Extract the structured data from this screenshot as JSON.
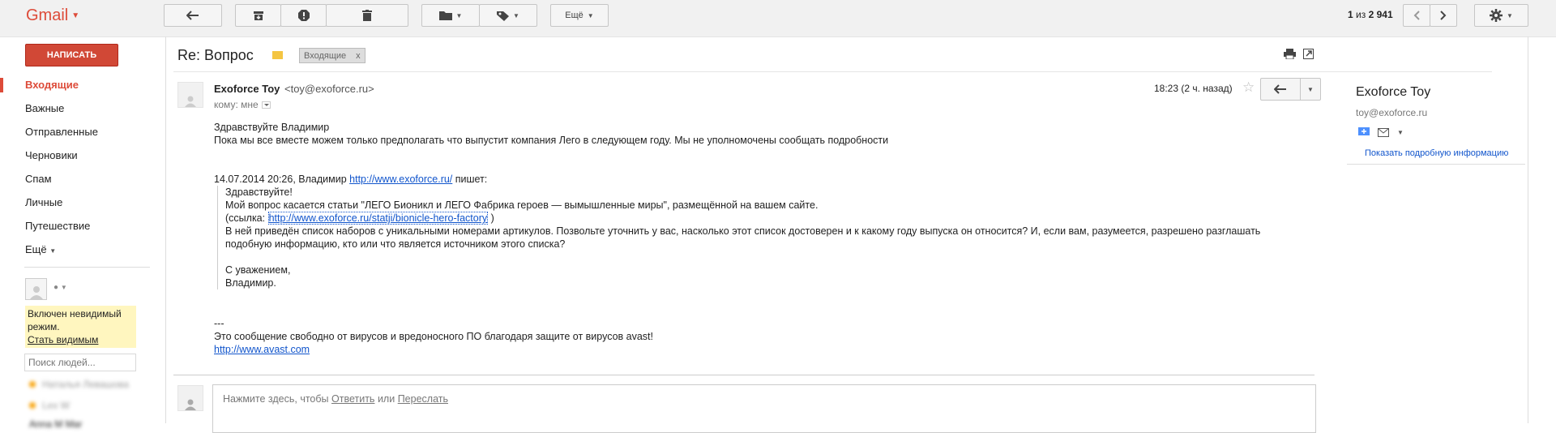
{
  "header": {
    "logo": "Gmail",
    "more_label": "Ещё",
    "pager": {
      "range": "1",
      "of_label": "из",
      "total": "2 941"
    }
  },
  "compose": {
    "label": "НАПИСАТЬ"
  },
  "sidebar": {
    "items": [
      {
        "label": "Входящие",
        "active": true
      },
      {
        "label": "Важные"
      },
      {
        "label": "Отправленные"
      },
      {
        "label": "Черновики"
      },
      {
        "label": "Спам"
      },
      {
        "label": "Личные"
      },
      {
        "label": "Путешествие"
      },
      {
        "label": "Ещё"
      }
    ],
    "chat": {
      "invisible_line1": "Включен невидимый",
      "invisible_line2": "режим.",
      "become_visible": "Стать видимым",
      "search_placeholder": "Поиск людей..."
    },
    "contacts": [
      "Наталья Левашова",
      "Lex W",
      "Anna M Mar"
    ]
  },
  "message": {
    "subject": "Re: Вопрос",
    "label_chip": "Входящие",
    "from_name": "Exoforce Toy",
    "from_email": "<toy@exoforce.ru>",
    "to_label": "кому: мне",
    "time": "18:23 (2 ч. назад)",
    "body": {
      "greeting": "Здравствуйте Владимир",
      "line1": "Пока мы все вместе можем только предполагать что выпустит компания Лего в следующем году. Мы не уполномочены сообщать подробности",
      "quote_header_prefix": "14.07.2014 20:26, Владимир",
      "quote_header_link": "http://www.exoforce.ru/",
      "quote_header_suffix": "пишет:",
      "quote": {
        "l1": "Здравствуйте!",
        "l2": "Мой вопрос касается статьи \"ЛЕГО Бионикл и ЛЕГО Фабрика героев — вымышленные миры\", размещённой на вашем сайте.",
        "l3_prefix": "(ссылка:",
        "l3_link": "http://www.exoforce.ru/statji/bionicle-hero-factory",
        "l3_suffix": ")",
        "l4": "В ней приведён список наборов с уникальными номерами артикулов. Позвольте уточнить у вас, насколько этот список достоверен и к какому году выпуска он относится? И, если вам, разумеется, разрешено разглашать",
        "l5": "подобную информацию, кто или что является источником этого списка?",
        "l6": "С уважением,",
        "l7": "Владимир."
      },
      "sig_dash": "---",
      "sig_text": "Это сообщение свободно от вирусов и вредоносного ПО благодаря защите от вирусов avast!",
      "sig_link": "http://www.avast.com"
    },
    "reply_prompt": {
      "prefix": "Нажмите здесь, чтобы",
      "reply": "Ответить",
      "or": "или",
      "forward": "Переслать"
    }
  },
  "contact_panel": {
    "name": "Exoforce Toy",
    "email": "toy@exoforce.ru",
    "more_info": "Показать подробную информацию"
  },
  "colors": {
    "brand": "#dd4b39",
    "compose": "#d14836",
    "link": "#1155cc",
    "label": "#f4c542"
  }
}
